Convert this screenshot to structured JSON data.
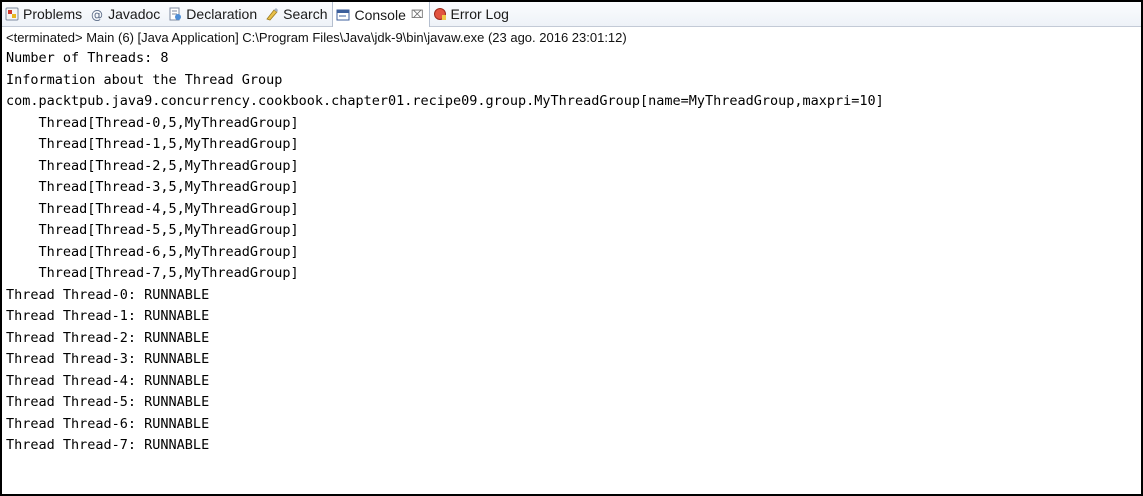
{
  "tabs": [
    {
      "label": "Problems",
      "icon": "problems-icon"
    },
    {
      "label": "Javadoc",
      "icon": "javadoc-icon"
    },
    {
      "label": "Declaration",
      "icon": "declaration-icon"
    },
    {
      "label": "Search",
      "icon": "search-icon"
    },
    {
      "label": "Console",
      "icon": "console-icon",
      "active": true,
      "close": "⌧"
    },
    {
      "label": "Error Log",
      "icon": "error-log-icon"
    }
  ],
  "status": "<terminated> Main (6) [Java Application] C:\\Program Files\\Java\\jdk-9\\bin\\javaw.exe (23 ago. 2016 23:01:12)",
  "console_lines": [
    "Number of Threads: 8",
    "Information about the Thread Group",
    "com.packtpub.java9.concurrency.cookbook.chapter01.recipe09.group.MyThreadGroup[name=MyThreadGroup,maxpri=10]",
    "    Thread[Thread-0,5,MyThreadGroup]",
    "    Thread[Thread-1,5,MyThreadGroup]",
    "    Thread[Thread-2,5,MyThreadGroup]",
    "    Thread[Thread-3,5,MyThreadGroup]",
    "    Thread[Thread-4,5,MyThreadGroup]",
    "    Thread[Thread-5,5,MyThreadGroup]",
    "    Thread[Thread-6,5,MyThreadGroup]",
    "    Thread[Thread-7,5,MyThreadGroup]",
    "Thread Thread-0: RUNNABLE",
    "Thread Thread-1: RUNNABLE",
    "Thread Thread-2: RUNNABLE",
    "Thread Thread-3: RUNNABLE",
    "Thread Thread-4: RUNNABLE",
    "Thread Thread-5: RUNNABLE",
    "Thread Thread-6: RUNNABLE",
    "Thread Thread-7: RUNNABLE"
  ],
  "colors": {
    "tab_bar_bg": "#eef2f8",
    "active_tab_bg": "#ffffff",
    "text": "#000000"
  }
}
